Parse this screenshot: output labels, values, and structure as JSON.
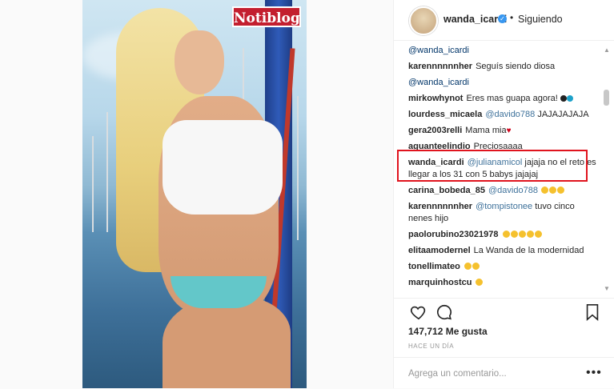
{
  "photo": {
    "logo_text": "Notiblog"
  },
  "header": {
    "username": "wanda_icardi",
    "separator": "•",
    "follow_status": "Siguiendo"
  },
  "comments": [
    {
      "user": "",
      "mention": "@wanda_icardi",
      "text": ""
    },
    {
      "user": "karennnnnnher",
      "mention": "",
      "text": "Seguís siendo diosa"
    },
    {
      "user": "",
      "mention": "@wanda_icardi",
      "text": ""
    },
    {
      "user": "mirkowhynot",
      "mention": "",
      "text": "Eres mas guapa agora!"
    },
    {
      "user": "lourdess_micaela",
      "mention": "@davido788",
      "text": "JAJAJAJAJA"
    },
    {
      "user": "gera2003relli",
      "mention": "",
      "text": "Mama mia"
    },
    {
      "user": "aguanteelindio",
      "mention": "",
      "text": "Preciosaaaa"
    },
    {
      "user": "wanda_icardi",
      "mention": "@julianamicol",
      "text": "jajaja no el reto es llegar a los 31 con 5 babys jajajaj"
    },
    {
      "user": "carina_bobeda_85",
      "mention": "@davido788",
      "text": ""
    },
    {
      "user": "karennnnnnher",
      "mention": "@tompistonee",
      "text": "tuvo cinco nenes hijo"
    },
    {
      "user": "paolorubino23021978",
      "mention": "",
      "text": ""
    },
    {
      "user": "elitaamodernel",
      "mention": "",
      "text": "La Wanda de la modernidad"
    },
    {
      "user": "tonellimateo",
      "mention": "",
      "text": ""
    },
    {
      "user": "marquinhostcu",
      "mention": "",
      "text": ""
    }
  ],
  "actions": {
    "likes": "147,712 Me gusta",
    "timestamp": "HACE UN DÍA",
    "add_comment_placeholder": "Agrega un comentario...",
    "more": "•••"
  },
  "colors": {
    "highlight_border": "#e0141e",
    "verified": "#3897f0",
    "mention": "#003569"
  }
}
